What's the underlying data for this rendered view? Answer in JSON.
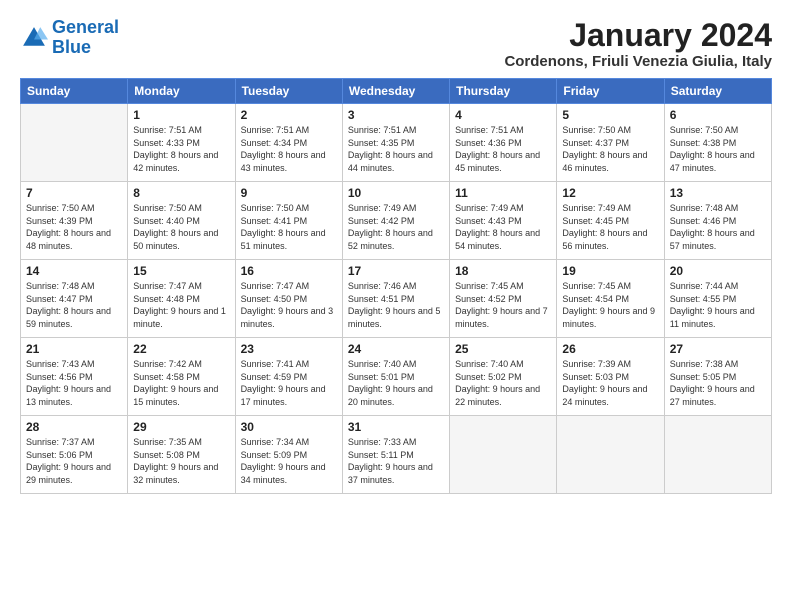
{
  "logo": {
    "line1": "General",
    "line2": "Blue"
  },
  "title": "January 2024",
  "subtitle": "Cordenons, Friuli Venezia Giulia, Italy",
  "days_of_week": [
    "Sunday",
    "Monday",
    "Tuesday",
    "Wednesday",
    "Thursday",
    "Friday",
    "Saturday"
  ],
  "weeks": [
    [
      {
        "day": "",
        "sunrise": "",
        "sunset": "",
        "daylight": ""
      },
      {
        "day": "1",
        "sunrise": "7:51 AM",
        "sunset": "4:33 PM",
        "daylight": "8 hours and 42 minutes."
      },
      {
        "day": "2",
        "sunrise": "7:51 AM",
        "sunset": "4:34 PM",
        "daylight": "8 hours and 43 minutes."
      },
      {
        "day": "3",
        "sunrise": "7:51 AM",
        "sunset": "4:35 PM",
        "daylight": "8 hours and 44 minutes."
      },
      {
        "day": "4",
        "sunrise": "7:51 AM",
        "sunset": "4:36 PM",
        "daylight": "8 hours and 45 minutes."
      },
      {
        "day": "5",
        "sunrise": "7:50 AM",
        "sunset": "4:37 PM",
        "daylight": "8 hours and 46 minutes."
      },
      {
        "day": "6",
        "sunrise": "7:50 AM",
        "sunset": "4:38 PM",
        "daylight": "8 hours and 47 minutes."
      }
    ],
    [
      {
        "day": "7",
        "sunrise": "7:50 AM",
        "sunset": "4:39 PM",
        "daylight": "8 hours and 48 minutes."
      },
      {
        "day": "8",
        "sunrise": "7:50 AM",
        "sunset": "4:40 PM",
        "daylight": "8 hours and 50 minutes."
      },
      {
        "day": "9",
        "sunrise": "7:50 AM",
        "sunset": "4:41 PM",
        "daylight": "8 hours and 51 minutes."
      },
      {
        "day": "10",
        "sunrise": "7:49 AM",
        "sunset": "4:42 PM",
        "daylight": "8 hours and 52 minutes."
      },
      {
        "day": "11",
        "sunrise": "7:49 AM",
        "sunset": "4:43 PM",
        "daylight": "8 hours and 54 minutes."
      },
      {
        "day": "12",
        "sunrise": "7:49 AM",
        "sunset": "4:45 PM",
        "daylight": "8 hours and 56 minutes."
      },
      {
        "day": "13",
        "sunrise": "7:48 AM",
        "sunset": "4:46 PM",
        "daylight": "8 hours and 57 minutes."
      }
    ],
    [
      {
        "day": "14",
        "sunrise": "7:48 AM",
        "sunset": "4:47 PM",
        "daylight": "8 hours and 59 minutes."
      },
      {
        "day": "15",
        "sunrise": "7:47 AM",
        "sunset": "4:48 PM",
        "daylight": "9 hours and 1 minute."
      },
      {
        "day": "16",
        "sunrise": "7:47 AM",
        "sunset": "4:50 PM",
        "daylight": "9 hours and 3 minutes."
      },
      {
        "day": "17",
        "sunrise": "7:46 AM",
        "sunset": "4:51 PM",
        "daylight": "9 hours and 5 minutes."
      },
      {
        "day": "18",
        "sunrise": "7:45 AM",
        "sunset": "4:52 PM",
        "daylight": "9 hours and 7 minutes."
      },
      {
        "day": "19",
        "sunrise": "7:45 AM",
        "sunset": "4:54 PM",
        "daylight": "9 hours and 9 minutes."
      },
      {
        "day": "20",
        "sunrise": "7:44 AM",
        "sunset": "4:55 PM",
        "daylight": "9 hours and 11 minutes."
      }
    ],
    [
      {
        "day": "21",
        "sunrise": "7:43 AM",
        "sunset": "4:56 PM",
        "daylight": "9 hours and 13 minutes."
      },
      {
        "day": "22",
        "sunrise": "7:42 AM",
        "sunset": "4:58 PM",
        "daylight": "9 hours and 15 minutes."
      },
      {
        "day": "23",
        "sunrise": "7:41 AM",
        "sunset": "4:59 PM",
        "daylight": "9 hours and 17 minutes."
      },
      {
        "day": "24",
        "sunrise": "7:40 AM",
        "sunset": "5:01 PM",
        "daylight": "9 hours and 20 minutes."
      },
      {
        "day": "25",
        "sunrise": "7:40 AM",
        "sunset": "5:02 PM",
        "daylight": "9 hours and 22 minutes."
      },
      {
        "day": "26",
        "sunrise": "7:39 AM",
        "sunset": "5:03 PM",
        "daylight": "9 hours and 24 minutes."
      },
      {
        "day": "27",
        "sunrise": "7:38 AM",
        "sunset": "5:05 PM",
        "daylight": "9 hours and 27 minutes."
      }
    ],
    [
      {
        "day": "28",
        "sunrise": "7:37 AM",
        "sunset": "5:06 PM",
        "daylight": "9 hours and 29 minutes."
      },
      {
        "day": "29",
        "sunrise": "7:35 AM",
        "sunset": "5:08 PM",
        "daylight": "9 hours and 32 minutes."
      },
      {
        "day": "30",
        "sunrise": "7:34 AM",
        "sunset": "5:09 PM",
        "daylight": "9 hours and 34 minutes."
      },
      {
        "day": "31",
        "sunrise": "7:33 AM",
        "sunset": "5:11 PM",
        "daylight": "9 hours and 37 minutes."
      },
      {
        "day": "",
        "sunrise": "",
        "sunset": "",
        "daylight": ""
      },
      {
        "day": "",
        "sunrise": "",
        "sunset": "",
        "daylight": ""
      },
      {
        "day": "",
        "sunrise": "",
        "sunset": "",
        "daylight": ""
      }
    ]
  ]
}
